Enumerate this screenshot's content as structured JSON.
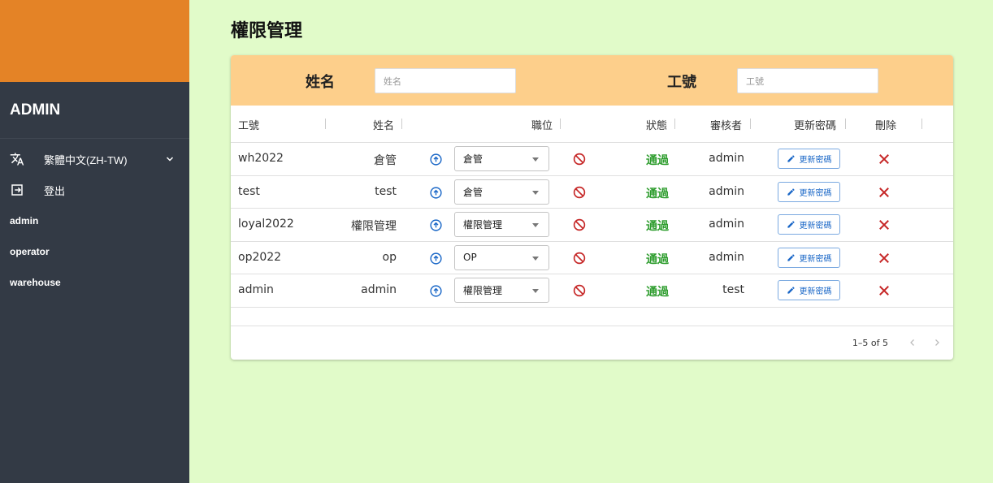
{
  "sidebar": {
    "title": "ADMIN",
    "language_label": "繁體中文(ZH-TW)",
    "logout_label": "登出",
    "items": [
      {
        "label": "admin"
      },
      {
        "label": "operator"
      },
      {
        "label": "warehouse"
      }
    ]
  },
  "page": {
    "title": "權限管理"
  },
  "filters": {
    "name_label": "姓名",
    "name_placeholder": "姓名",
    "id_label": "工號",
    "id_placeholder": "工號"
  },
  "table": {
    "headers": [
      "工號",
      "姓名",
      "職位",
      "狀態",
      "審核者",
      "更新密碼",
      "刪除"
    ],
    "rows": [
      {
        "id": "wh2022",
        "name": "倉管",
        "role": "倉管",
        "status": "通過",
        "reviewer": "admin",
        "pw_label": "更新密碼"
      },
      {
        "id": "test",
        "name": "test",
        "role": "倉管",
        "status": "通過",
        "reviewer": "admin",
        "pw_label": "更新密碼"
      },
      {
        "id": "loyal2022",
        "name": "權限管理",
        "role": "權限管理",
        "status": "通過",
        "reviewer": "admin",
        "pw_label": "更新密碼"
      },
      {
        "id": "op2022",
        "name": "op",
        "role": "OP",
        "status": "通過",
        "reviewer": "admin",
        "pw_label": "更新密碼"
      },
      {
        "id": "admin",
        "name": "admin",
        "role": "權限管理",
        "status": "通過",
        "reviewer": "test",
        "pw_label": "更新密碼"
      }
    ]
  },
  "pagination": {
    "range": "1–5 of 5"
  },
  "colors": {
    "sidebar_bg": "#333a45",
    "sidebar_top": "#e48326",
    "page_bg": "#e1fbc9",
    "filter_bg": "#fdcf8b",
    "status_green": "#2e9d2e",
    "link_blue": "#1a67c7",
    "delete_red": "#c62828"
  },
  "icons": {
    "language": "translate-icon",
    "logout": "logout-icon",
    "promote": "arrow-up-circle-icon",
    "ban": "ban-icon",
    "edit": "pencil-icon",
    "delete": "close-icon"
  }
}
